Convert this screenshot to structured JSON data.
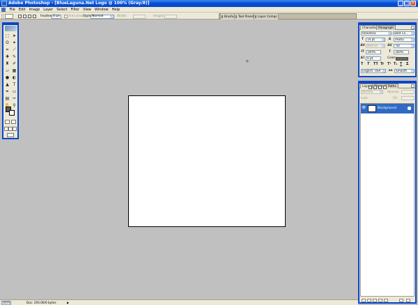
{
  "window": {
    "title": "Adobe Photoshop - [BlueLaguna.Net Logo @ 100% (Gray/8)]",
    "minimize": "_",
    "maximize": "□",
    "close": "×"
  },
  "menu": [
    "File",
    "Edit",
    "Image",
    "Layer",
    "Select",
    "Filter",
    "View",
    "Window",
    "Help"
  ],
  "options_bar": {
    "feather_label": "Feather:",
    "feather_value": "0 px",
    "antialias_label": "Anti-alias",
    "style_label": "Style:",
    "style_value": "Normal",
    "width_label": "Width:",
    "height_label": "Height:"
  },
  "palette_well": [
    "Brushes",
    "Tool Presets",
    "Layer Comps"
  ],
  "character_palette": {
    "tabs": [
      "Character",
      "Paragraph"
    ],
    "font_family": "Helvetica",
    "font_style": "Bold Co...",
    "font_size": "14 pt",
    "leading": "(Auto)",
    "kerning": "Metrics",
    "tracking": "-50",
    "vertical_scale": "100%",
    "horizontal_scale": "100%",
    "baseline_shift": "0 pt",
    "color_label": "Color:",
    "text_styles": [
      "T",
      "T",
      "TT",
      "Tr",
      "T¹",
      "T₁",
      "T",
      "T"
    ],
    "language": "English: USA",
    "antialias_symbol": "aa",
    "antialias": "Smooth",
    "color_value": "#6a6a6a"
  },
  "layers_palette": {
    "tabs": [
      "Layers",
      "Channels",
      "Paths"
    ],
    "blend_mode": "Normal",
    "opacity_label": "Opacity:",
    "lock_label": "Lock:",
    "fill_label": "Fill:",
    "layers": [
      {
        "name": "Background",
        "visible": true,
        "locked": true
      }
    ]
  },
  "status_bar": {
    "zoom": "100%",
    "doc_info": "Doc: 293.0K/0 bytes",
    "arrow": "▶"
  },
  "colors": {
    "accent": "#0a46c8",
    "workspace": "#c0c0c0",
    "selected_layer": "#316ac5",
    "foreground_swatch": "#5a5a5a",
    "background_swatch": "#ffffff"
  },
  "icons": {
    "eye": "👁",
    "crosshair": "+"
  }
}
